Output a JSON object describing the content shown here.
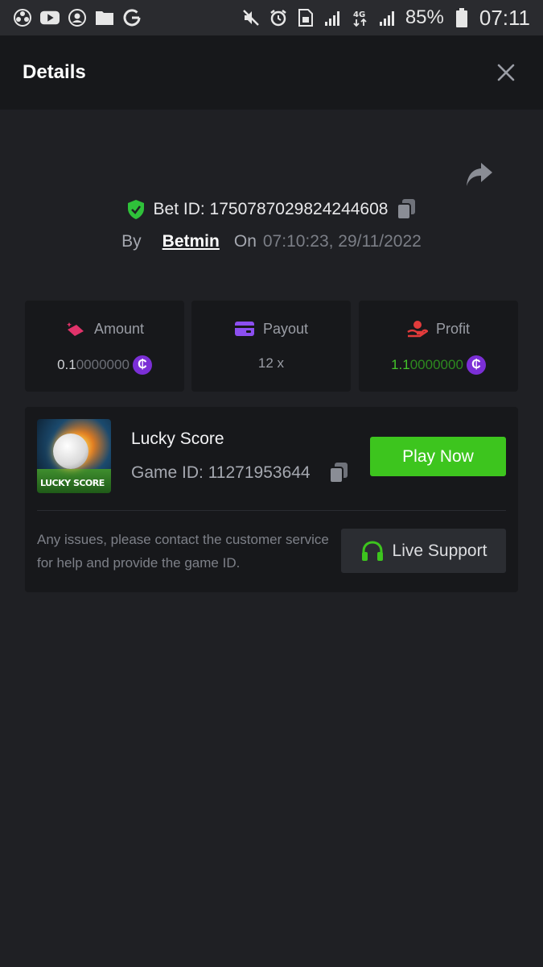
{
  "status_bar": {
    "left_icons": [
      "app-icon",
      "youtube-icon",
      "account-icon",
      "folder-icon",
      "google-icon"
    ],
    "right_icons": [
      "mute-icon",
      "alarm-icon",
      "sim-icon",
      "signal-icon",
      "data-4g-icon",
      "signal-icon"
    ],
    "battery_percent": "85%",
    "time": "07:11"
  },
  "header": {
    "title": "Details",
    "close_icon": "close-icon"
  },
  "share_icon": "share-icon",
  "bet": {
    "id_label": "Bet ID: 1750787029824244608",
    "by_label": "By",
    "username": "Betmin",
    "on_label": "On",
    "datetime": "07:10:23, 29/11/2022"
  },
  "stats": {
    "amount": {
      "label": "Amount",
      "value_lead": "0.1",
      "value_trail": "0000000",
      "icon": "amount-icon"
    },
    "payout": {
      "label": "Payout",
      "value": "12 x",
      "icon": "wallet-icon"
    },
    "profit": {
      "label": "Profit",
      "value_lead": "1.1",
      "value_trail": "0000000",
      "icon": "profit-icon"
    },
    "currency_symbol": "₵"
  },
  "game": {
    "name": "Lucky Score",
    "thumb_label": "LUCKY SCORE",
    "id_label": "Game ID: 11271953644",
    "play_label": "Play Now",
    "help_text": "Any issues, please contact the customer service for help and provide the game ID.",
    "support_label": "Live Support"
  },
  "colors": {
    "background": "#1f2024",
    "card": "#17181b",
    "accent_green": "#3dc51e",
    "coin_purple": "#7b2fd6",
    "amount_icon_pink": "#e0336a",
    "payout_icon_purple": "#8c4ff0",
    "profit_icon_red": "#e23b3b",
    "shield_green": "#2fc13a"
  }
}
